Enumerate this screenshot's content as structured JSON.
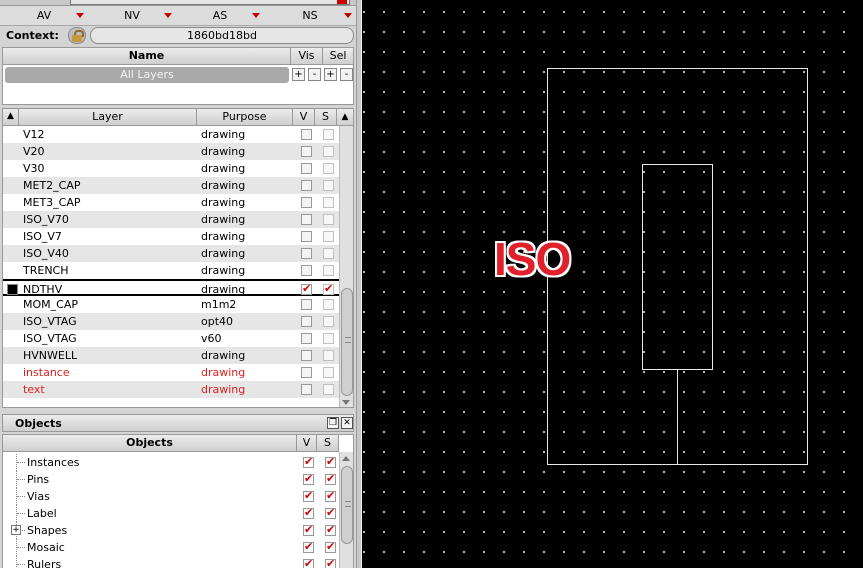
{
  "filters": {
    "av": "AV",
    "nv": "NV",
    "as": "AS",
    "ns": "NS"
  },
  "context": {
    "label": "Context:",
    "value": "1860bd18bd"
  },
  "lpp_panel": {
    "col_name": "Name",
    "col_vis": "Vis",
    "col_sel": "Sel",
    "all_layers": "All Layers",
    "buttons": [
      "+",
      "-",
      "+",
      "-"
    ]
  },
  "layers_panel": {
    "col_layer": "Layer",
    "col_purpose": "Purpose",
    "col_v": "V",
    "col_s": "S",
    "rows": [
      {
        "layer": "V12",
        "purpose": "drawing"
      },
      {
        "layer": "V20",
        "purpose": "drawing"
      },
      {
        "layer": "V30",
        "purpose": "drawing"
      },
      {
        "layer": "MET2_CAP",
        "purpose": "drawing"
      },
      {
        "layer": "MET3_CAP",
        "purpose": "drawing"
      },
      {
        "layer": "ISO_V70",
        "purpose": "drawing"
      },
      {
        "layer": "ISO_V7",
        "purpose": "drawing"
      },
      {
        "layer": "ISO_V40",
        "purpose": "drawing"
      },
      {
        "layer": "TRENCH",
        "purpose": "drawing"
      },
      {
        "layer": "NDTHV",
        "purpose": "drawing",
        "selected": true,
        "v": true,
        "s": true
      },
      {
        "layer": "MOM_CAP",
        "purpose": "m1m2"
      },
      {
        "layer": "ISO_VTAG",
        "purpose": "opt40"
      },
      {
        "layer": "ISO_VTAG",
        "purpose": "v60"
      },
      {
        "layer": "HVNWELL",
        "purpose": "drawing"
      },
      {
        "layer": "instance",
        "purpose": "drawing",
        "red": true
      },
      {
        "layer": "text",
        "purpose": "drawing",
        "red": true
      }
    ]
  },
  "objects_panel": {
    "title": "Objects",
    "col_objects": "Objects",
    "col_v": "V",
    "col_s": "S",
    "rows": [
      {
        "name": "Instances"
      },
      {
        "name": "Pins"
      },
      {
        "name": "Vias"
      },
      {
        "name": "Label"
      },
      {
        "name": "Shapes",
        "expandable": true
      },
      {
        "name": "Mosaic"
      },
      {
        "name": "Rulers"
      }
    ]
  },
  "canvas": {
    "shape_label": "ISO"
  },
  "colors": {
    "accent_red": "#d00000",
    "canvas_bg": "#000000",
    "label_red": "#e02020"
  }
}
